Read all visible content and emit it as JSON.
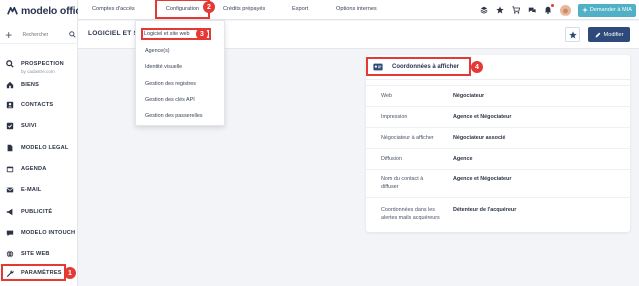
{
  "app": {
    "logo_text": "modelo office"
  },
  "sidebar": {
    "search_placeholder": "Rechercher",
    "items": [
      {
        "label": "PROSPECTION",
        "sub": "by cadastre.com",
        "icon": "search-icon"
      },
      {
        "label": "BIENS",
        "icon": "home-icon"
      },
      {
        "label": "CONTACTS",
        "icon": "contact-icon"
      },
      {
        "label": "SUIVI",
        "icon": "followup-icon"
      },
      {
        "label": "MODELO LEGAL",
        "icon": "document-icon"
      },
      {
        "label": "AGENDA",
        "icon": "calendar-icon"
      },
      {
        "label": "E-MAIL",
        "icon": "mail-icon"
      },
      {
        "label": "PUBLICITÉ",
        "icon": "megaphone-icon"
      },
      {
        "label": "MODELO INTOUCH",
        "icon": "intouch-icon"
      },
      {
        "label": "SITE WEB",
        "icon": "globe-icon"
      },
      {
        "label": "PARAMÈTRES",
        "icon": "wrench-icon",
        "active": true
      }
    ]
  },
  "topnav": {
    "tabs": [
      "Comptes d'accès",
      "Configuration",
      "Crédits prépayés",
      "Export",
      "Options internes"
    ],
    "active_tab": "Configuration",
    "mia_label": "Demander à MIA"
  },
  "page": {
    "title": "LOGICIEL ET SI",
    "edit_label": "Modifier"
  },
  "dropdown": {
    "items": [
      "Logiciel et site web",
      "Agence(s)",
      "Identité visuelle",
      "Gestion des registres",
      "Gestion des clés API",
      "Gestion des passerelles"
    ],
    "active_item": "Logiciel et site web"
  },
  "card": {
    "title": "Coordonnées à afficher",
    "rows": [
      {
        "label": "Web",
        "value": "Négociateur"
      },
      {
        "label": "Impression",
        "value": "Agence et Négociateur"
      },
      {
        "label": "Négociateur à afficher",
        "value": "Négociateur associé"
      },
      {
        "label": "Diffusion",
        "value": "Agence"
      },
      {
        "label": "Nom du contact à diffuser",
        "value": "Agence et Négociateur"
      },
      {
        "label": "Coordonnées dans les alertes mails acquéreurs",
        "value": "Détenteur de l'acquéreur"
      }
    ]
  },
  "badges": [
    "1",
    "2",
    "3",
    "4"
  ],
  "colors": {
    "accent_red": "#e53935",
    "primary_navy": "#2e4a7a",
    "mia_teal": "#4fb0c6"
  }
}
